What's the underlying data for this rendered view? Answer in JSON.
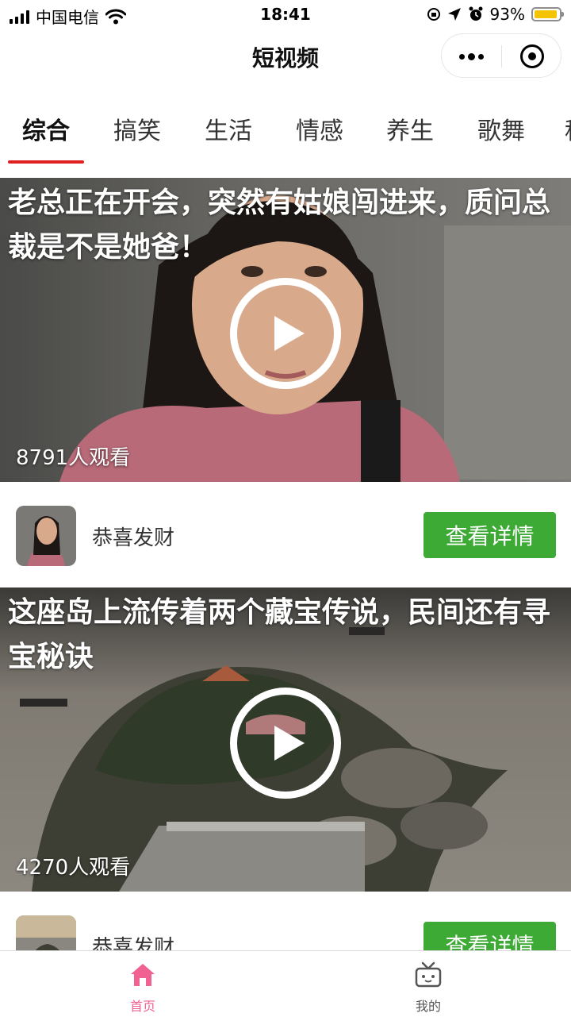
{
  "status_bar": {
    "carrier": "中国电信",
    "time": "18:41",
    "battery_percent": "93%",
    "battery_level": 0.93,
    "battery_color": "#f5c400"
  },
  "nav": {
    "title": "短视频",
    "more_icon": "more-dots-icon",
    "close_icon": "target-close-icon"
  },
  "tabs": {
    "items": [
      {
        "label": "综合"
      },
      {
        "label": "搞笑"
      },
      {
        "label": "生活"
      },
      {
        "label": "情感"
      },
      {
        "label": "养生"
      },
      {
        "label": "歌舞"
      },
      {
        "label": "科"
      }
    ],
    "active_index": 0,
    "accent_color": "#e02020"
  },
  "videos": [
    {
      "title": "老总正在开会，突然有姑娘闯进来，质问总裁是不是她爸！",
      "views": "8791人观看",
      "author": "恭喜发财",
      "detail_button": "查看详情"
    },
    {
      "title": "这座岛上流传着两个藏宝传说，民间还有寻宝秘诀",
      "views": "4270人观看",
      "author": "恭喜发财",
      "detail_button": "查看详情"
    }
  ],
  "detail_button_color": "#3daa35",
  "tab_bar": {
    "items": [
      {
        "label": "首页",
        "icon": "home-icon",
        "active": true
      },
      {
        "label": "我的",
        "icon": "tv-icon",
        "active": false
      }
    ],
    "active_color": "#f06292",
    "inactive_color": "#555555"
  }
}
